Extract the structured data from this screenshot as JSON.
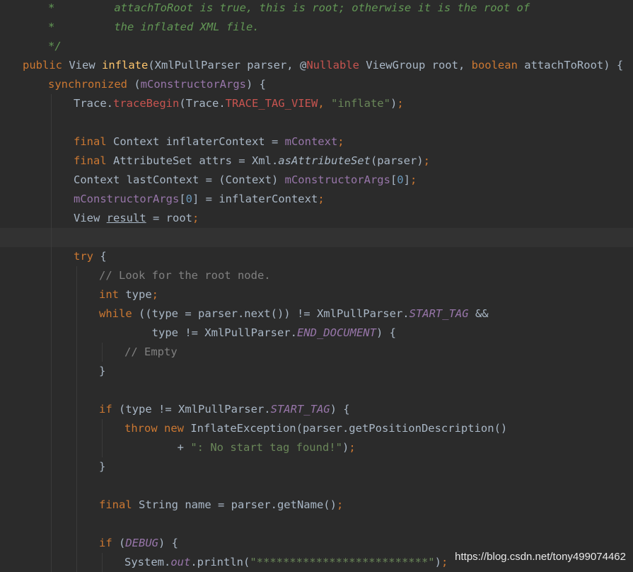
{
  "watermark": "https://blog.csdn.net/tony499074462",
  "colors": {
    "background": "#2b2b2b",
    "text": "#a9b7c6",
    "keyword": "#cc7832",
    "field": "#9876aa",
    "method": "#ffc66d",
    "string": "#6a8759",
    "number": "#6897bb",
    "comment": "#808080",
    "doc_comment": "#629755",
    "annotation_name": "#c75450"
  },
  "lines": [
    {
      "indent": 1,
      "tokens": [
        [
          "doc",
          "*         attachToRoot is true, this is root; otherwise it is the root of"
        ]
      ]
    },
    {
      "indent": 1,
      "tokens": [
        [
          "doc",
          "*         the inflated XML file."
        ]
      ]
    },
    {
      "indent": 1,
      "tokens": [
        [
          "doc",
          "*/"
        ]
      ]
    },
    {
      "indent": 0,
      "tokens": [
        [
          "kw",
          "public "
        ],
        [
          "",
          "View "
        ],
        [
          "fn",
          "inflate"
        ],
        [
          "",
          "(XmlPullParser parser, "
        ],
        [
          "",
          "@"
        ],
        [
          "ann-red",
          "Nullable"
        ],
        [
          "",
          " ViewGroup root, "
        ],
        [
          "kw",
          "boolean "
        ],
        [
          "",
          "attachToRoot) {"
        ]
      ]
    },
    {
      "indent": 1,
      "tokens": [
        [
          "kw",
          "synchronized "
        ],
        [
          "",
          "("
        ],
        [
          "field",
          "mConstructorArgs"
        ],
        [
          "",
          ") {"
        ]
      ]
    },
    {
      "indent": 2,
      "tokens": [
        [
          "",
          "Trace."
        ],
        [
          "err",
          "traceBegin"
        ],
        [
          "",
          "(Trace."
        ],
        [
          "err",
          "TRACE_TAG_VIEW"
        ],
        [
          "kw",
          ", "
        ],
        [
          "str",
          "\"inflate\""
        ],
        [
          "",
          ")"
        ],
        [
          "kw",
          ";"
        ]
      ]
    },
    {
      "indent": 2,
      "tokens": []
    },
    {
      "indent": 2,
      "tokens": [
        [
          "kw",
          "final "
        ],
        [
          "",
          "Context inflaterContext = "
        ],
        [
          "field",
          "mContext"
        ],
        [
          "kw",
          ";"
        ]
      ]
    },
    {
      "indent": 2,
      "tokens": [
        [
          "kw",
          "final "
        ],
        [
          "",
          "AttributeSet attrs = Xml."
        ],
        [
          "it",
          "asAttributeSet"
        ],
        [
          "",
          "(parser)"
        ],
        [
          "kw",
          ";"
        ]
      ]
    },
    {
      "indent": 2,
      "tokens": [
        [
          "",
          "Context lastContext = (Context) "
        ],
        [
          "field",
          "mConstructorArgs"
        ],
        [
          "",
          "["
        ],
        [
          "num",
          "0"
        ],
        [
          "",
          "]"
        ],
        [
          "kw",
          ";"
        ]
      ]
    },
    {
      "indent": 2,
      "tokens": [
        [
          "field",
          "mConstructorArgs"
        ],
        [
          "",
          "["
        ],
        [
          "num",
          "0"
        ],
        [
          "",
          "] = inflaterContext"
        ],
        [
          "kw",
          ";"
        ]
      ]
    },
    {
      "indent": 2,
      "tokens": [
        [
          "",
          "View "
        ],
        [
          "ul",
          "result"
        ],
        [
          "",
          " = root"
        ],
        [
          "kw",
          ";"
        ]
      ]
    },
    {
      "indent": 2,
      "current": true,
      "tokens": []
    },
    {
      "indent": 2,
      "tokens": [
        [
          "kw",
          "try "
        ],
        [
          "",
          "{"
        ]
      ]
    },
    {
      "indent": 3,
      "tokens": [
        [
          "com",
          "// Look for the root node."
        ]
      ]
    },
    {
      "indent": 3,
      "tokens": [
        [
          "kw",
          "int "
        ],
        [
          "",
          "type"
        ],
        [
          "kw",
          ";"
        ]
      ]
    },
    {
      "indent": 3,
      "tokens": [
        [
          "kw",
          "while "
        ],
        [
          "",
          "((type = parser.next()) != XmlPullParser."
        ],
        [
          "sm",
          "START_TAG"
        ],
        [
          "",
          " &&"
        ]
      ]
    },
    {
      "indent": 3,
      "tokens": [
        [
          "",
          "        type != XmlPullParser."
        ],
        [
          "sm",
          "END_DOCUMENT"
        ],
        [
          "",
          ") {"
        ]
      ]
    },
    {
      "indent": 4,
      "tokens": [
        [
          "com",
          "// Empty"
        ]
      ]
    },
    {
      "indent": 3,
      "tokens": [
        [
          "",
          "}"
        ]
      ]
    },
    {
      "indent": 3,
      "tokens": []
    },
    {
      "indent": 3,
      "tokens": [
        [
          "kw",
          "if "
        ],
        [
          "",
          "(type != XmlPullParser."
        ],
        [
          "sm",
          "START_TAG"
        ],
        [
          "",
          ") {"
        ]
      ]
    },
    {
      "indent": 4,
      "tokens": [
        [
          "kw",
          "throw new "
        ],
        [
          "",
          "InflateException(parser.getPositionDescription()"
        ]
      ]
    },
    {
      "indent": 4,
      "tokens": [
        [
          "",
          "        + "
        ],
        [
          "str",
          "\": No start tag found!\""
        ],
        [
          "",
          ")"
        ],
        [
          "kw",
          ";"
        ]
      ]
    },
    {
      "indent": 3,
      "tokens": [
        [
          "",
          "}"
        ]
      ]
    },
    {
      "indent": 3,
      "tokens": []
    },
    {
      "indent": 3,
      "tokens": [
        [
          "kw",
          "final "
        ],
        [
          "",
          "String name = parser.getName()"
        ],
        [
          "kw",
          ";"
        ]
      ]
    },
    {
      "indent": 3,
      "tokens": []
    },
    {
      "indent": 3,
      "tokens": [
        [
          "kw",
          "if "
        ],
        [
          "",
          "("
        ],
        [
          "sm",
          "DEBUG"
        ],
        [
          "",
          ") {"
        ]
      ]
    },
    {
      "indent": 4,
      "tokens": [
        [
          "",
          "System."
        ],
        [
          "sm",
          "out"
        ],
        [
          "",
          ".println("
        ],
        [
          "str",
          "\"**************************\""
        ],
        [
          "",
          ")"
        ],
        [
          "kw",
          ";"
        ]
      ]
    }
  ]
}
